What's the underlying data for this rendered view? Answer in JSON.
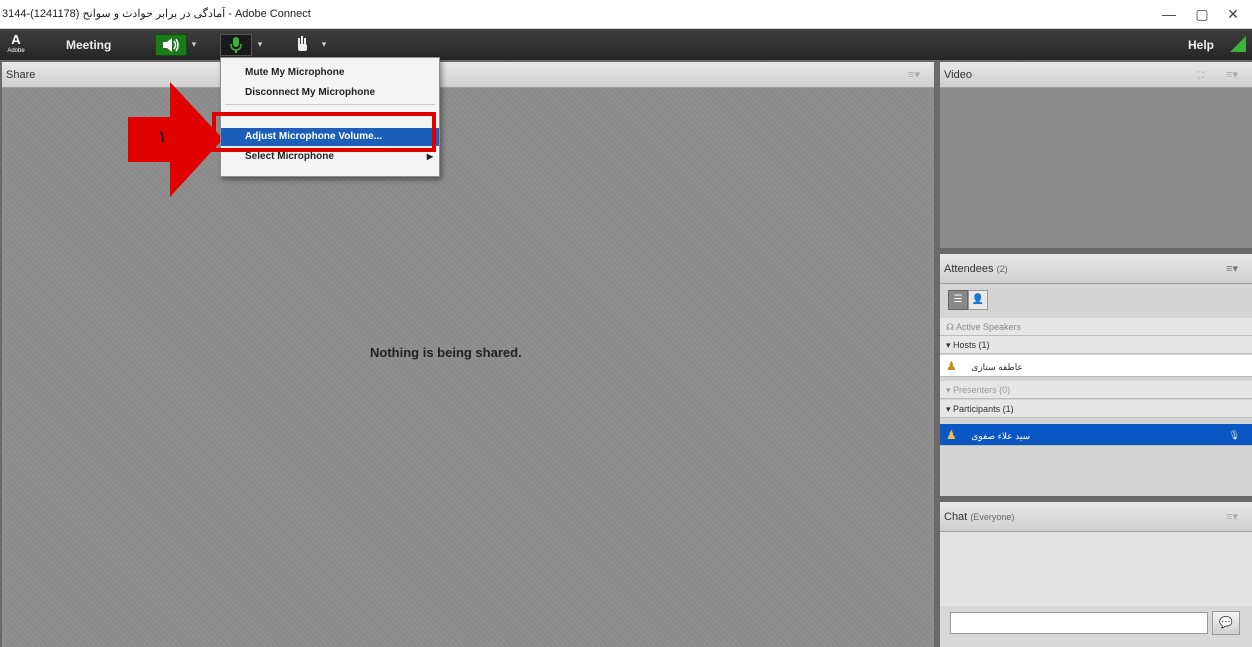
{
  "window": {
    "title": "3144-(1241178) آمادگی در برابر حوادث و سوانح - Adobe Connect",
    "minimize": "—",
    "restore": "▢",
    "close": "✕"
  },
  "menubar": {
    "logo": "A",
    "logo_sub": "Adobe",
    "meeting_label": "Meeting",
    "help_label": "Help"
  },
  "share_pod": {
    "title": "Share",
    "empty_message": "Nothing is being shared."
  },
  "mic_menu": {
    "items": [
      {
        "label": "Mute My Microphone"
      },
      {
        "label": "Disconnect My Microphone"
      },
      {
        "label": "Adjust Microphone Volume..."
      },
      {
        "label": "Select Microphone"
      }
    ]
  },
  "annotation": {
    "number": "١",
    "highlight_color": "#e00000"
  },
  "video_pod": {
    "title": "Video"
  },
  "attendees_pod": {
    "title": "Attendees",
    "count": "(2)",
    "active_speakers": "Active Speakers",
    "hosts_label": "Hosts (1)",
    "host_name": "عاطفه ستاری",
    "presenters_label": "Presenters (0)",
    "participants_label": "Participants (1)",
    "participant_name": "سید علاء صفوی"
  },
  "chat_pod": {
    "title": "Chat",
    "scope": "(Everyone)",
    "input_value": ""
  },
  "colors": {
    "accent": "#1c5fb8",
    "selection_row": "#0a56c2",
    "status_green": "#3bb33b"
  }
}
